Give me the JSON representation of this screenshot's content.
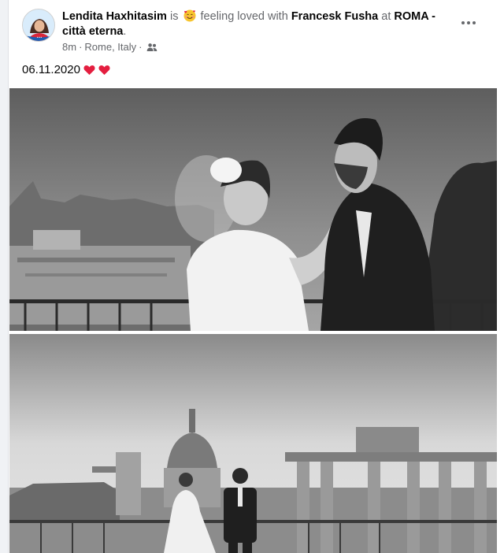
{
  "post": {
    "author": "Lendita Haxhitasim",
    "is_word": "is",
    "feeling": "feeling loved with",
    "tagged_person": "Francesk Fusha",
    "at_word": "at",
    "place": "ROMA - città eterna",
    "period": ".",
    "time": "8m",
    "separator": "·",
    "location": "Rome, Italy",
    "location_separator": "·",
    "audience_icon": "people-icon",
    "feeling_icon": "smiling-face-with-hearts-icon",
    "text": "06.11.2020",
    "text_emojis": [
      "heart-icon",
      "heart-icon"
    ],
    "more_icon": "more-horizontal-icon"
  },
  "colors": {
    "card_bg": "#ffffff",
    "page_bg": "#f0f2f5",
    "primary_text": "#050505",
    "secondary_text": "#65676b",
    "heart": "#e41e3f"
  }
}
